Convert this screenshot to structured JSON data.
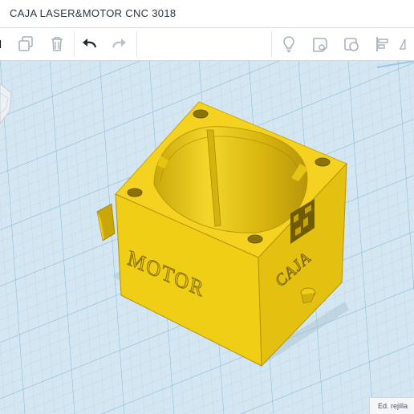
{
  "app": {
    "title": "CAJA LASER&MOTOR CNC 3018"
  },
  "toolbar": {
    "icons": [
      "duplicate-icon",
      "delete-icon",
      "undo-icon",
      "redo-icon",
      "light-bulb-icon",
      "note-icon",
      "shape-icon",
      "align-icon",
      "mirror-icon"
    ]
  },
  "model": {
    "engraving_front": "MOTOR",
    "engraving_side": "CAJA",
    "color": "#f4d21f"
  },
  "status": {
    "grid_label": "Ed. rejilla"
  },
  "colors": {
    "workplane": "#d4e6f1",
    "grid_line": "#a9cde2",
    "model_top": "#f4d21f",
    "model_front": "#f0ce16",
    "model_side": "#e2bd0c"
  }
}
